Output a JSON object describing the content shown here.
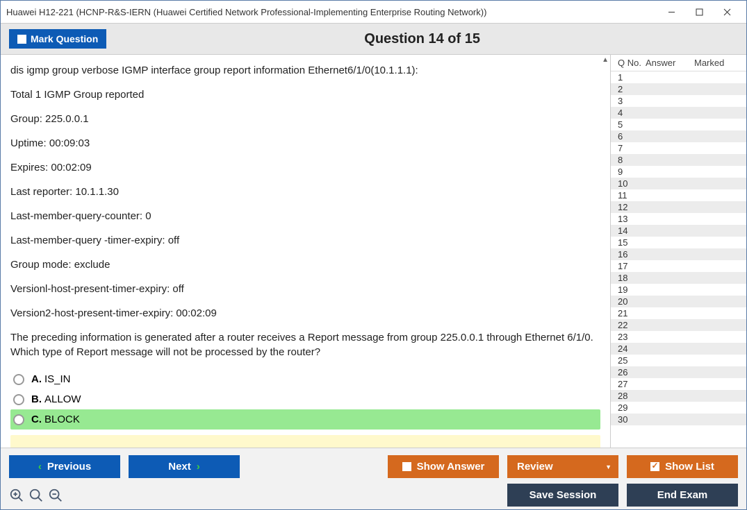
{
  "window": {
    "title": "Huawei H12-221 (HCNP-R&S-IERN (Huawei Certified Network Professional-Implementing Enterprise Routing Network))"
  },
  "header": {
    "mark_label": "Mark Question",
    "question_title": "Question 14 of 15"
  },
  "question": {
    "lines": [
      "dis igmp group verbose IGMP interface group report information Ethernet6/1/0(10.1.1.1):",
      "Total 1 IGMP Group reported",
      "Group: 225.0.0.1",
      "Uptime: 00:09:03",
      "Expires: 00:02:09",
      "Last reporter: 10.1.1.30",
      "Last-member-query-counter: 0",
      "Last-member-query -timer-expiry: off",
      "Group mode: exclude",
      "Versionl-host-present-timer-expiry: off",
      "Version2-host-present-timer-expiry: 00:02:09",
      "The preceding information is generated after a router receives a Report message from group 225.0.0.1 through Ethernet 6/1/0. Which type of Report message will not be processed by the router?"
    ],
    "options": [
      {
        "letter": "A.",
        "text": "IS_IN",
        "selected": false
      },
      {
        "letter": "B.",
        "text": "ALLOW",
        "selected": false
      },
      {
        "letter": "C.",
        "text": "BLOCK",
        "selected": true
      }
    ]
  },
  "side": {
    "headers": {
      "qno": "Q No.",
      "answer": "Answer",
      "marked": "Marked"
    },
    "rows": [
      "1",
      "2",
      "3",
      "4",
      "5",
      "6",
      "7",
      "8",
      "9",
      "10",
      "11",
      "12",
      "13",
      "14",
      "15",
      "16",
      "17",
      "18",
      "19",
      "20",
      "21",
      "22",
      "23",
      "24",
      "25",
      "26",
      "27",
      "28",
      "29",
      "30"
    ]
  },
  "footer": {
    "previous": "Previous",
    "next": "Next",
    "show_answer": "Show Answer",
    "review": "Review",
    "show_list": "Show List",
    "save_session": "Save Session",
    "end_exam": "End Exam"
  }
}
